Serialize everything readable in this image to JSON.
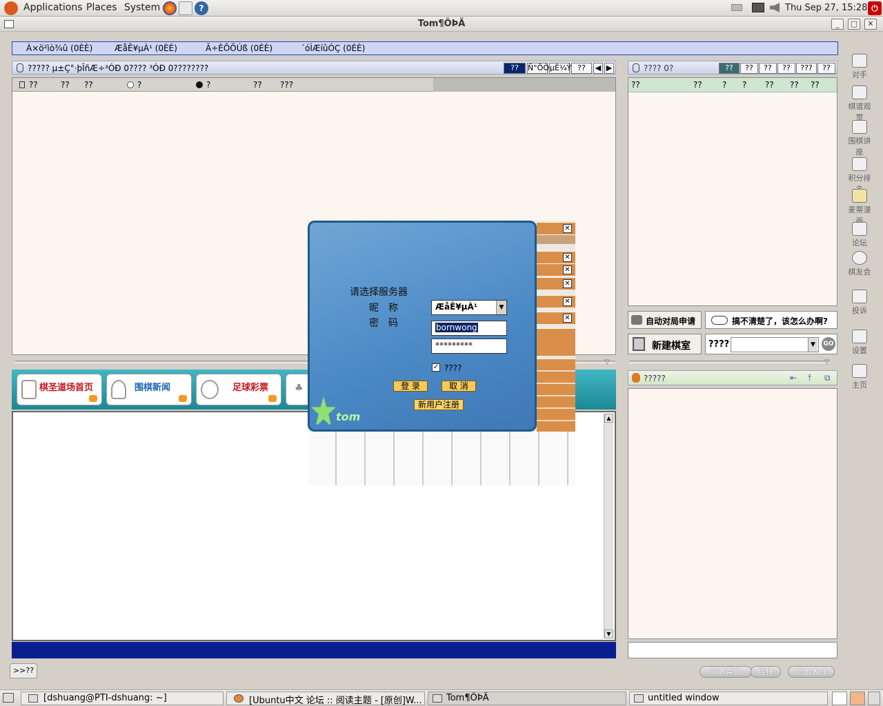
{
  "top_panel": {
    "menus": [
      "Applications",
      "Places",
      "System"
    ],
    "clock": "Thu Sep 27, 15:28"
  },
  "window": {
    "title": "Tom¶ÔÞÄ"
  },
  "app_menu": [
    "À×ö²ìò¾û (0ÈÈ)",
    "ÆåÊ¥µÀ¹ (0ÈÈ)",
    "Ã÷ÈÕÕÚß (0ÈÈ)",
    "´óÌÆíûÓÇ (0ÈÈ)"
  ],
  "room_toolbar": {
    "text": "?????  µ±Ç°·þÎñÆ÷³ÓÐ  0????  ³ÓÐ  0????????",
    "tabs": [
      "??",
      "Ñ°ÕÒ",
      "µÈ¼Ý",
      "??"
    ]
  },
  "room_header": [
    "??",
    "??",
    "??",
    "?",
    "?",
    "??",
    "???"
  ],
  "player_toolbar": {
    "text": "????   0?",
    "tabs": [
      "??",
      "??",
      "??",
      "??",
      "???",
      "??"
    ]
  },
  "player_header": [
    "??",
    "??",
    "?",
    "?",
    "??",
    "??",
    "??"
  ],
  "sidebar": [
    {
      "label": "对手",
      "icon": "opponent-icon"
    },
    {
      "label": "棋谱观赏",
      "icon": "game-record-icon"
    },
    {
      "label": "围棋讲座",
      "icon": "lecture-icon"
    },
    {
      "label": "积分排名",
      "icon": "ranking-icon"
    },
    {
      "label": "麦蒂漫画",
      "icon": "comic-icon"
    },
    {
      "label": "论坛",
      "icon": "forum-icon"
    },
    {
      "label": "棋友会",
      "icon": "club-icon"
    },
    {
      "label": "投诉",
      "icon": "complaint-icon"
    },
    {
      "label": "设置",
      "icon": "settings-icon"
    },
    {
      "label": "主页",
      "icon": "home-icon"
    }
  ],
  "right_buttons": {
    "auto_match": "自动对局申请",
    "help": "搞不清楚了，该怎么办啊?",
    "new_room": "新建棋室",
    "room_label": "????",
    "room_go": "GO"
  },
  "chat_panel": {
    "title": "?????"
  },
  "nav_cards": [
    "棋圣道场首页",
    "围棋新闻",
    "足球彩票"
  ],
  "login": {
    "server_prompt": "请选择服务器",
    "nickname_label": "昵　称",
    "password_label": "密　码",
    "server_value": "ÆåÊ¥µÀ¹",
    "nickname_value": "bornwong",
    "password_value": "*********",
    "remember_label": "????",
    "login_button": "登 录",
    "cancel_button": "取 消",
    "register_button": "新用户注册",
    "logo": "tom"
  },
  "status_tab": ">>??",
  "footer_buttons": [
    "请求帮助",
    "信件",
    "退出大厅"
  ],
  "taskbar": [
    "[dshuang@PTI-dshuang: ~]",
    "[Ubuntu中文 论坛 :: 阅读主题 - [原创]W...",
    "Tom¶ÔÞÄ",
    "untitled window"
  ],
  "colors": {
    "accent": "#0a246a",
    "pane": "#fdf5ef",
    "login_blue": "#4a88c5"
  }
}
